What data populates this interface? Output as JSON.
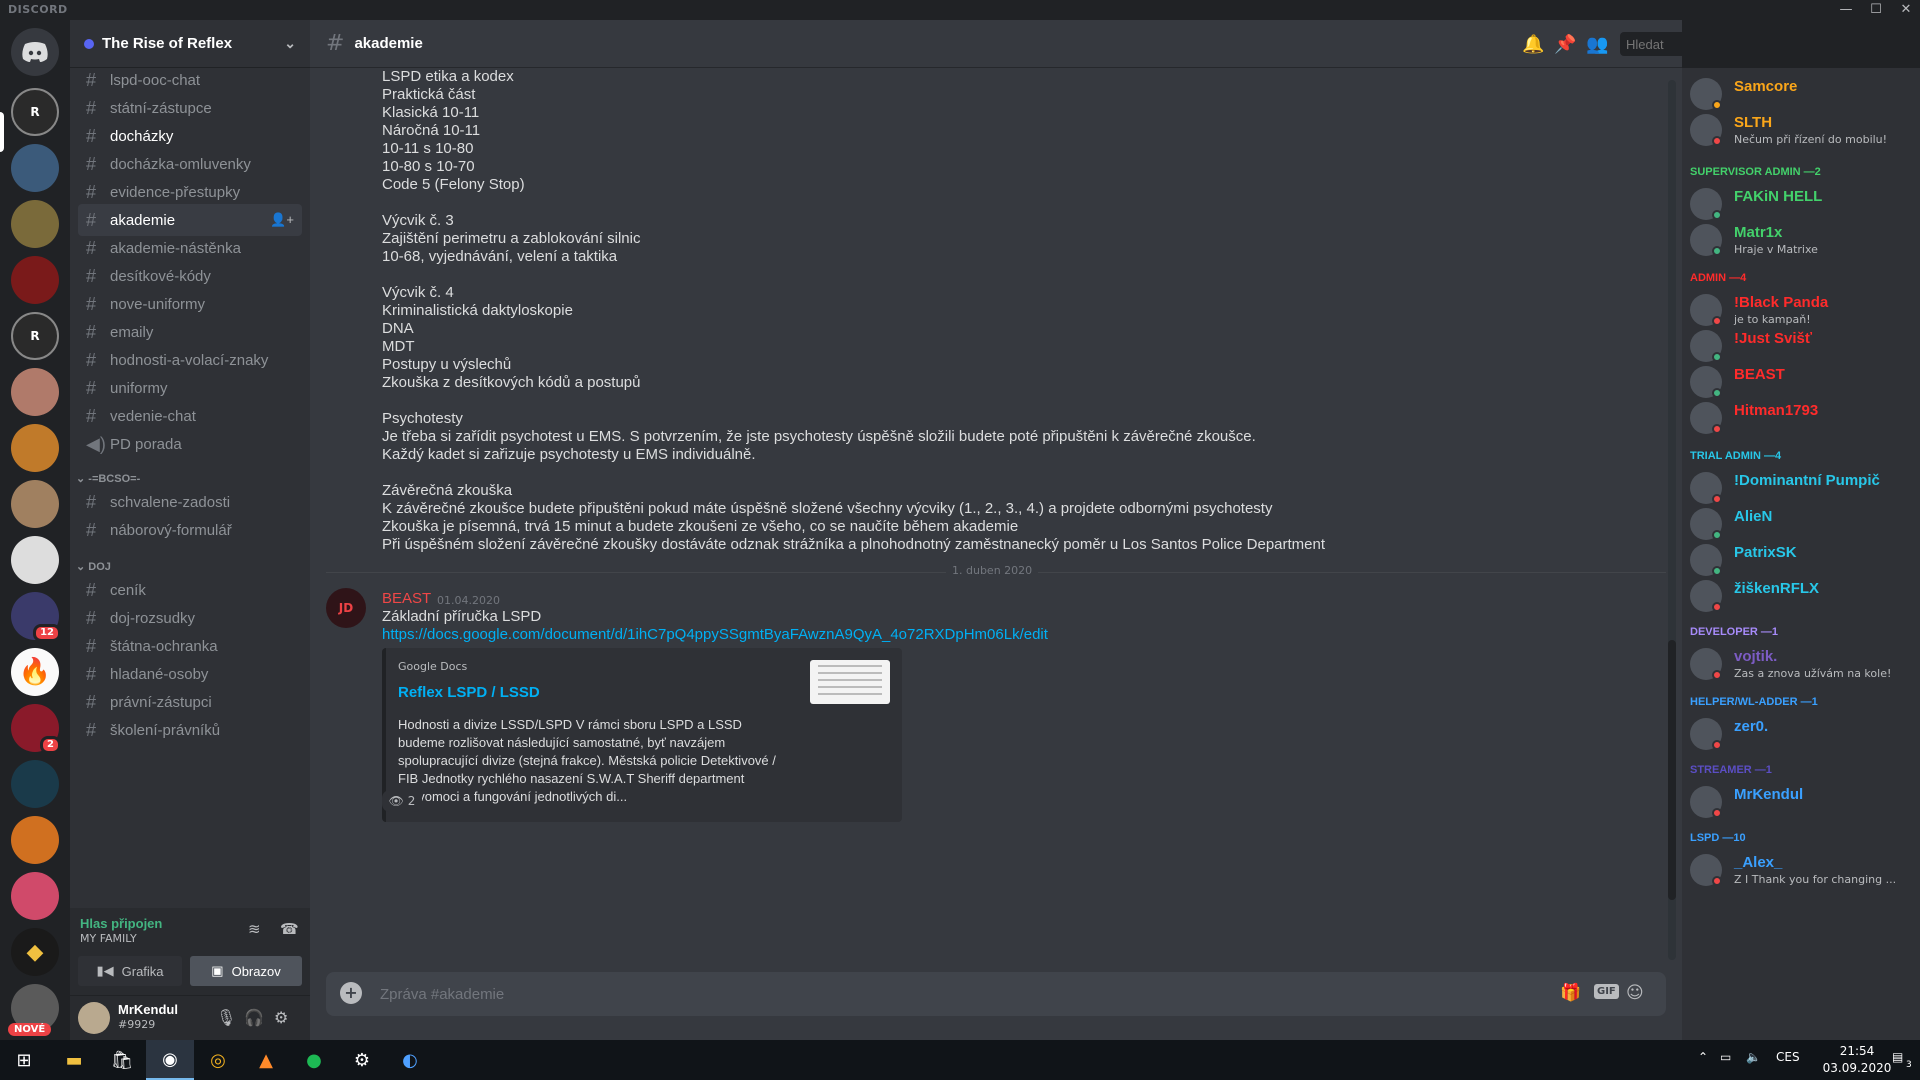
{
  "app": {
    "brand": "DISCORD"
  },
  "window_controls": {
    "minimize": "—",
    "maximize": "☐",
    "close": "✕"
  },
  "rail": {
    "new_label": "NOVÉ",
    "badges": [
      "12",
      "2"
    ]
  },
  "guild": {
    "name": "The Rise of Reflex"
  },
  "channels": [
    {
      "name": "lspd-ooc-chat",
      "state": "normal"
    },
    {
      "name": "státní-zástupce",
      "state": "normal"
    },
    {
      "name": "docházky",
      "state": "bold"
    },
    {
      "name": "docházka-omluvenky",
      "state": "normal"
    },
    {
      "name": "evidence-přestupky",
      "state": "normal"
    },
    {
      "name": "akademie",
      "state": "active"
    },
    {
      "name": "akademie-nástěnka",
      "state": "normal"
    },
    {
      "name": "desítkové-kódy",
      "state": "normal"
    },
    {
      "name": "nove-uniformy",
      "state": "normal"
    },
    {
      "name": "emaily",
      "state": "normal"
    },
    {
      "name": "hodnosti-a-volací-znaky",
      "state": "normal"
    },
    {
      "name": "uniformy",
      "state": "normal"
    },
    {
      "name": "vedenie-chat",
      "state": "normal"
    },
    {
      "name": "PD porada",
      "state": "voice"
    }
  ],
  "category_bcso": "-=BCSO=-",
  "channels_bcso": [
    {
      "name": "schvalene-zadosti"
    },
    {
      "name": "náborový-formulář"
    }
  ],
  "category_doj": "DOJ",
  "channels_doj": [
    {
      "name": "ceník"
    },
    {
      "name": "doj-rozsudky"
    },
    {
      "name": "štátna-ochranka"
    },
    {
      "name": "hladané-osoby"
    },
    {
      "name": "právní-zástupci"
    },
    {
      "name": "školení-právníků"
    }
  ],
  "voice": {
    "status": "Hlas připojen",
    "channel": "MY FAMILY",
    "video_button": "Grafika",
    "screen_button": "Obrazov"
  },
  "user": {
    "name": "MrKendul",
    "discriminator": "#9929"
  },
  "chat": {
    "channel": "akademie",
    "search_placeholder": "Hledat",
    "composer_placeholder": "Zpráva #akademie",
    "lines": [
      "LSPD etika a kodex",
      "Praktická část",
      "Klasická 10-11",
      "Náročná 10-11",
      "10-11 s 10-80",
      "10-80 s 10-70",
      "Code 5 (Felony Stop)",
      "",
      "Výcvik č. 3",
      "Zajištění perimetru a zablokování silnic",
      "10-68, vyjednávání, velení a taktika",
      "",
      "Výcvik č. 4",
      "Kriminalistická daktyloskopie",
      "DNA",
      "MDT",
      "Postupy u výslechů",
      "Zkouška z desítkových kódů a postupů",
      "",
      "Psychotesty",
      "Je třeba si zařídit psychotest u EMS. S potvrzením, že jste psychotesty úspěšně složili budete poté připuštěni k závěrečné zkoušce.",
      "Každý kadet si zařizuje psychotesty u EMS individuálně.",
      "",
      "Závěrečná zkouška",
      "K závěrečné zkoušce budete připuštěni pokud máte úspěšně složené všechny výcviky (1., 2., 3., 4.) a projdete odbornými psychotesty",
      "Zkouška je písemná, trvá 15 minut a budete zkoušeni ze všeho, co se naučíte během akademie",
      "Při úspěšném složení závěrečné zkoušky dostáváte odznak strážníka a plnohodnotný zaměstnanecký poměr u Los Santos Police Department"
    ],
    "date_divider": "1. duben 2020",
    "message": {
      "author": "BEAST",
      "timestamp": "01.04.2020",
      "text": "Základní příručka LSPD",
      "link": "https://docs.google.com/document/d/1ihC7pQ4ppySSgmtByaFAwznA9QyA_4o72RXDpHm06Lk/edit",
      "embed": {
        "provider": "Google Docs",
        "title": "Reflex LSPD / LSSD",
        "description": "Hodnosti a divize LSSD/LSPD V rámci sboru LSPD a LSSD budeme rozlišovat následující samostatné, byť navzájem spolupracující divize (stejná frakce). Městská policie Detektivové / FIB Jednotky rychlého nasazení S.W.A.T Sheriff department Pravomoci a fungování jednotlivých di..."
      },
      "reaction_count": "2"
    }
  },
  "members": {
    "groups": [
      {
        "role": "",
        "color": "#faa61a",
        "items": [
          {
            "name": "Samcore",
            "sub": "",
            "color": "#faa61a",
            "status": "#faa61a"
          },
          {
            "name": "SLTH",
            "sub": "Nečum při řízení do mobilu!",
            "color": "#faa61a",
            "status": "#f04747"
          }
        ]
      },
      {
        "role": "SUPERVISOR ADMIN —2",
        "color": "#43d16b",
        "items": [
          {
            "name": "FAKiN HELL",
            "sub": "",
            "color": "#43d16b",
            "status": "#43b581"
          },
          {
            "name": "Matr1x",
            "sub": "Hraje v Matrixe",
            "color": "#43d16b",
            "status": "#43b581"
          }
        ]
      },
      {
        "role": "ADMIN —4",
        "color": "#ff2b2b",
        "items": [
          {
            "name": "!Black Panda",
            "sub": "je to kampaň!",
            "color": "#ff2b2b",
            "status": "#f04747"
          },
          {
            "name": "!Just Svišť",
            "sub": "",
            "color": "#ff2b2b",
            "status": "#43b581"
          },
          {
            "name": "BEAST",
            "sub": "",
            "color": "#ff2b2b",
            "status": "#43b581"
          },
          {
            "name": "Hitman1793",
            "sub": "",
            "color": "#ff2b2b",
            "status": "#f04747"
          }
        ]
      },
      {
        "role": "TRIAL ADMIN —4",
        "color": "#28c7e8",
        "items": [
          {
            "name": "!Dominantní Pumpič",
            "sub": "",
            "color": "#28c7e8",
            "status": "#f04747"
          },
          {
            "name": "AlieN",
            "sub": "",
            "color": "#28c7e8",
            "status": "#43b581"
          },
          {
            "name": "PatrixSK",
            "sub": "",
            "color": "#28c7e8",
            "status": "#43b581"
          },
          {
            "name": "žiškenRFLX",
            "sub": "",
            "color": "#28c7e8",
            "status": "#f04747"
          }
        ]
      },
      {
        "role": "DEVELOPER —1",
        "color": "#a78bfa",
        "items": [
          {
            "name": "vojtik.",
            "sub": "Zas a znova užívám na kole!",
            "color": "#7c5cc4",
            "status": "#f04747"
          }
        ]
      },
      {
        "role": "HELPER/WL-ADDER —1",
        "color": "#3aa0ff",
        "items": [
          {
            "name": "zer0.",
            "sub": "",
            "color": "#3aa0ff",
            "status": "#f04747"
          }
        ]
      },
      {
        "role": "STREAMER —1",
        "color": "#5b4ec4",
        "items": [
          {
            "name": "MrKendul",
            "sub": "",
            "color": "#3aa0ff",
            "status": "#f04747"
          }
        ]
      },
      {
        "role": "LSPD —10",
        "color": "#3aa0ff",
        "items": [
          {
            "name": "_Alex_",
            "sub": "Z I Thank you for changing ...",
            "color": "#3aa0ff",
            "status": "#f04747"
          }
        ]
      }
    ]
  },
  "taskbar": {
    "time": "21:54",
    "date": "03.09.2020",
    "lang": "CES",
    "notif_count": "3"
  },
  "colors": {
    "accent": "#5865f2",
    "link": "#00b0f4",
    "online": "#43b581",
    "dnd": "#f04747"
  }
}
